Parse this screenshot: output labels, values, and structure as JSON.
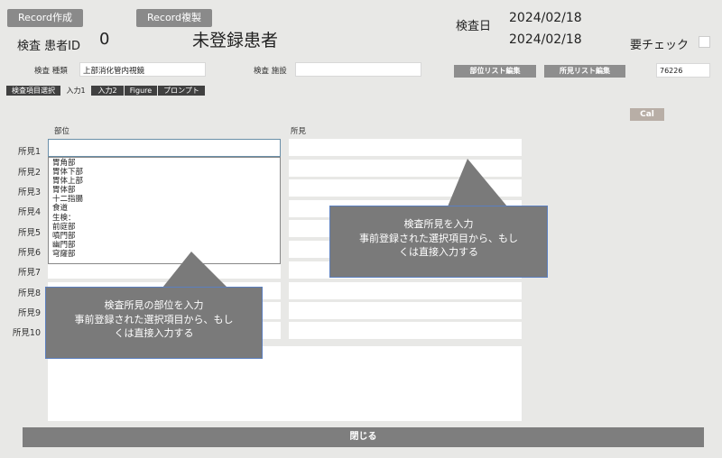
{
  "toolbar": {
    "record_create": "Record作成",
    "record_copy": "Record複製"
  },
  "header": {
    "patient_id_label": "検査 患者ID",
    "patient_id_value": "0",
    "patient_name": "未登録患者",
    "exam_date_label": "検査日",
    "exam_date_1": "2024/02/18",
    "exam_date_2": "2024/02/18",
    "check_label": "要チェック"
  },
  "form": {
    "exam_type_label": "検査 種類",
    "exam_type_value": "上部消化管内視鏡",
    "facility_label": "検査 施設",
    "facility_value": "",
    "site_list_edit": "部位リスト編集",
    "finding_list_edit": "所見リスト編集",
    "code_value": "76226"
  },
  "tabs": [
    "検査項目選択",
    "入力1",
    "入力2",
    "Figure",
    "プロンプト"
  ],
  "cal_button": "Cal",
  "columns": {
    "site": "部位",
    "finding": "所見"
  },
  "rows": [
    "所見1",
    "所見2",
    "所見3",
    "所見4",
    "所見5",
    "所見6",
    "所見7",
    "所見8",
    "所見9",
    "所見10"
  ],
  "dropdown_items": [
    "胃角部",
    "胃体下部",
    "胃体上部",
    "胃体部",
    "十二指腸",
    "食道",
    "生検：",
    "前庭部",
    "噴門部",
    "幽門部",
    "穹窿部"
  ],
  "callouts": {
    "finding_line1": "検査所見を入力",
    "finding_line2": "事前登録された選択項目から、もし",
    "finding_line3": "くは直接入力する",
    "site_line1": "検査所見の部位を入力",
    "site_line2": "事前登録された選択項目から、もし",
    "site_line3": "くは直接入力する"
  },
  "close_button": "閉じる",
  "colors": {
    "button_gray": "#8a8a8a",
    "cal_button": "#b8aea6",
    "focus_border": "#6a8fa8",
    "callout_border": "#5b7fbf"
  }
}
